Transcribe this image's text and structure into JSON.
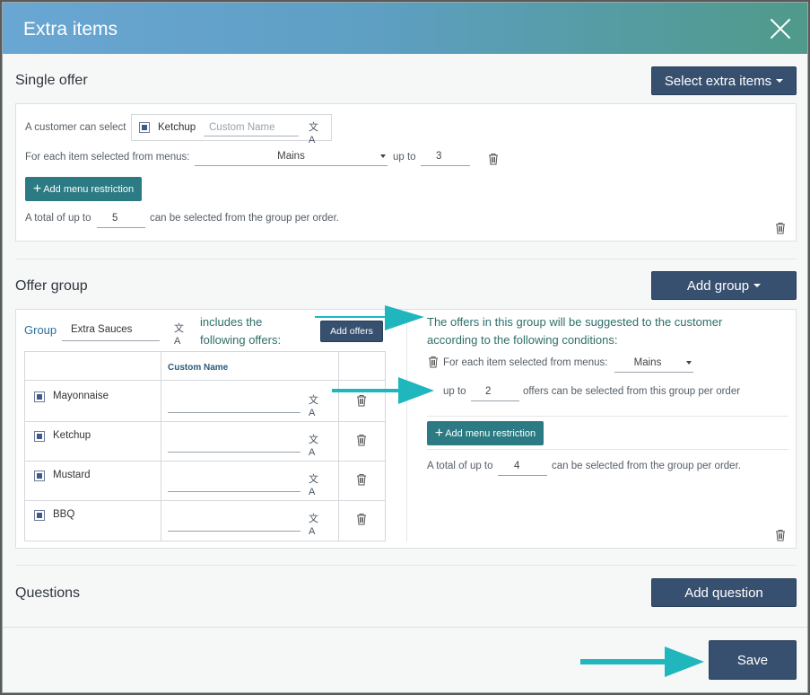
{
  "modal": {
    "title": "Extra items"
  },
  "single_offer": {
    "title": "Single offer",
    "select_button": "Select extra items",
    "customer_select_label": "A customer can select",
    "item_name": "Ketchup",
    "custom_name_placeholder": "Custom Name",
    "menus_label": "For each item selected from menus:",
    "menu_value": "Mains",
    "up_to_label": "up to",
    "up_to_value": "3",
    "add_restriction_label": "Add menu restriction",
    "total_prefix": "A total of up to",
    "total_value": "5",
    "total_suffix": "can be selected from the group per order."
  },
  "offer_group": {
    "title": "Offer group",
    "add_group_button": "Add group",
    "group_label": "Group",
    "group_name": "Extra Sauces",
    "includes_text_1": "includes the",
    "includes_text_2": "following offers:",
    "add_offers_button": "Add offers",
    "table_header_custom": "Custom Name",
    "items": [
      {
        "name": "Mayonnaise"
      },
      {
        "name": "Ketchup"
      },
      {
        "name": "Mustard"
      },
      {
        "name": "BBQ"
      }
    ],
    "conditions_line1": "The offers in this group will be suggested to the customer",
    "conditions_line2": "according to the following conditions:",
    "menus_label": "For each item selected from menus:",
    "menu_value": "Mains",
    "up_to_label": "up to",
    "up_to_value": "2",
    "offers_suffix": "offers can be selected from this group per order",
    "add_restriction_label": "Add menu restriction",
    "total_prefix": "A total of up to",
    "total_value": "4",
    "total_suffix": "can be selected from the group per order."
  },
  "questions": {
    "title": "Questions",
    "add_question_button": "Add question"
  },
  "footer": {
    "save_button": "Save"
  },
  "colors": {
    "arrow": "#1fb7bd",
    "dark_button": "#37506f",
    "teal_button": "#2c7a84"
  }
}
